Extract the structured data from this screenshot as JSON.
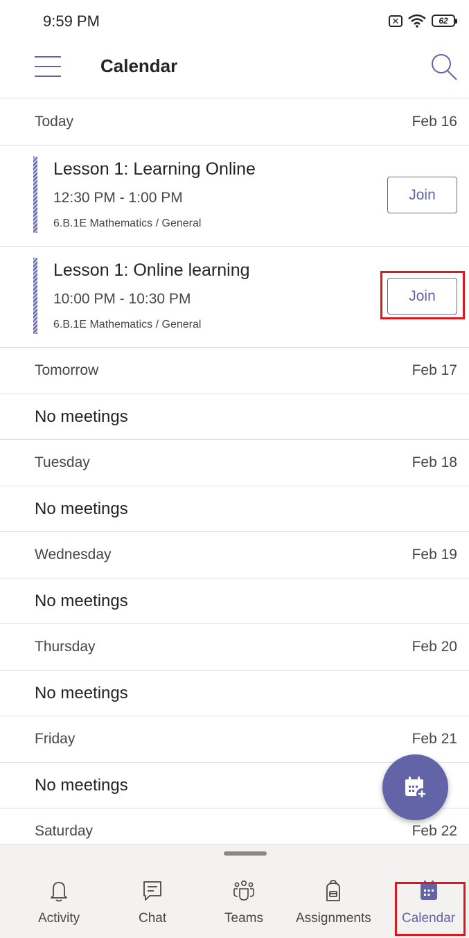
{
  "status_bar": {
    "time": "9:59 PM",
    "sim_icon_label": "✕",
    "battery": "62"
  },
  "header": {
    "title": "Calendar"
  },
  "days": {
    "today": {
      "label": "Today",
      "date": "Feb 16"
    },
    "tomorrow": {
      "label": "Tomorrow",
      "date": "Feb 17"
    },
    "tuesday": {
      "label": "Tuesday",
      "date": "Feb 18"
    },
    "wednesday": {
      "label": "Wednesday",
      "date": "Feb 19"
    },
    "thursday": {
      "label": "Thursday",
      "date": "Feb 20"
    },
    "friday": {
      "label": "Friday",
      "date": "Feb 21"
    },
    "saturday": {
      "label": "Saturday",
      "date": "Feb 22"
    }
  },
  "meetings": [
    {
      "title": "Lesson 1: Learning Online",
      "time": "12:30 PM - 1:00 PM",
      "channel": "6.B.1E Mathematics / General",
      "join_label": "Join"
    },
    {
      "title": "Lesson 1: Online learning",
      "time": "10:00 PM - 10:30 PM",
      "channel": "6.B.1E Mathematics / General",
      "join_label": "Join"
    }
  ],
  "empty_label": "No meetings",
  "nav": [
    {
      "label": "Activity",
      "icon": "bell-icon"
    },
    {
      "label": "Chat",
      "icon": "chat-icon"
    },
    {
      "label": "Teams",
      "icon": "teams-icon"
    },
    {
      "label": "Assignments",
      "icon": "backpack-icon"
    },
    {
      "label": "Calendar",
      "icon": "calendar-icon",
      "active": true
    }
  ],
  "colors": {
    "accent": "#6264a7",
    "highlight": "#e0161f",
    "divider": "#e1dfdd"
  }
}
